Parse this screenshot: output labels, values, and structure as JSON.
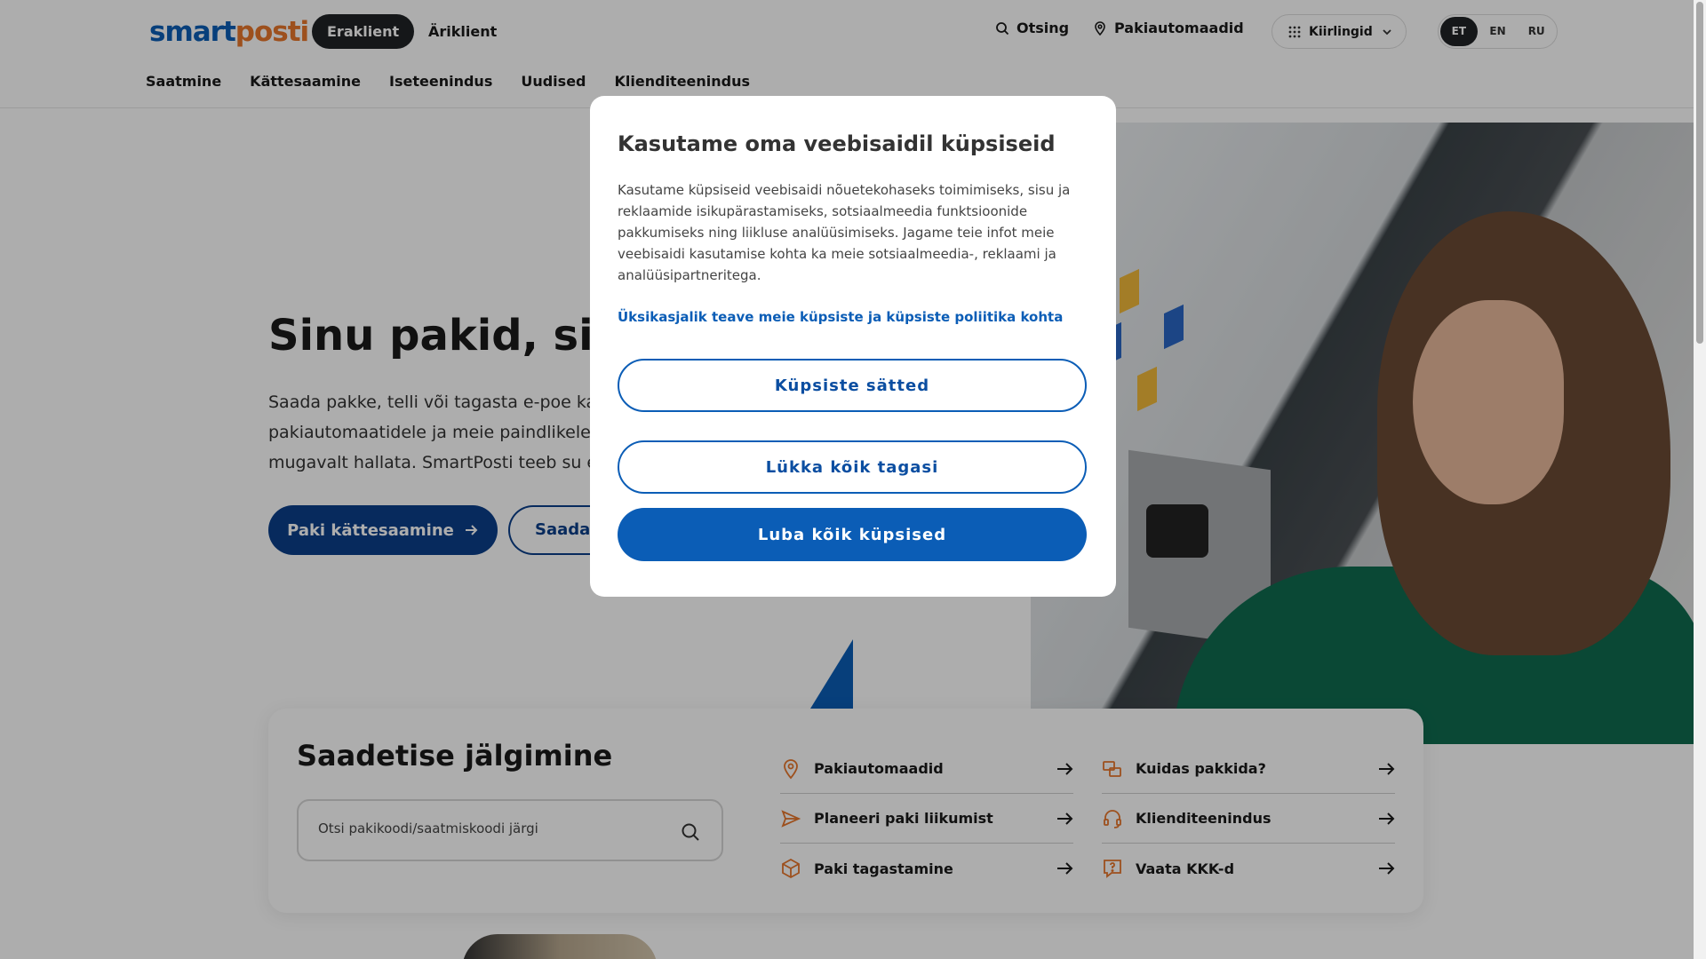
{
  "header": {
    "logo_part1": "smart",
    "logo_part2": "posti",
    "segment_active": "Eraklient",
    "segment_other": "Äriklient",
    "search_label": "Otsing",
    "lockers_label": "Pakiautomaadid",
    "quicklinks_label": "Kiirlingid",
    "languages": [
      "ET",
      "EN",
      "RU"
    ],
    "active_language": "ET"
  },
  "nav": [
    "Saatmine",
    "Kättesaamine",
    "Iseteenindus",
    "Uudised",
    "Klienditeenindus"
  ],
  "hero": {
    "title": "Sinu pakid, sinu",
    "text_line1": "Saada pakke, telli või tagasta e-poe kaup",
    "text_line2": "pakiautomaatidele ja meie paindlikele ta",
    "text_line3": "mugavalt hallata. SmartPosti teeb su elu",
    "primary_button": "Paki kättesaamine",
    "secondary_button": "Saada"
  },
  "tracking": {
    "title": "Saadetise jälgimine",
    "placeholder": "Otsi pakikoodi/saatmiskoodi järgi",
    "links": [
      {
        "label": "Pakiautomaadid",
        "icon": "location-pin-icon"
      },
      {
        "label": "Kuidas pakkida?",
        "icon": "packages-icon"
      },
      {
        "label": "Planeeri paki liikumist",
        "icon": "send-icon"
      },
      {
        "label": "Klienditeenindus",
        "icon": "headset-icon"
      },
      {
        "label": "Paki tagastamine",
        "icon": "box-return-icon"
      },
      {
        "label": "Vaata KKK-d",
        "icon": "faq-icon"
      }
    ]
  },
  "cookie_modal": {
    "title": "Kasutame oma veebisaidil küpsiseid",
    "body": "Kasutame küpsiseid veebisaidi nõuetekohaseks toimimiseks, sisu ja reklaamide isikupärastamiseks, sotsiaalmeedia funktsioonide pakkumiseks ning liikluse analüüsimiseks. Jagame teie infot meie veebisaidi kasutamise kohta ka meie sotsiaalmeedia-, reklaami ja analüüsipartneritega.",
    "policy_link": "Üksikasjalik teave meie küpsiste ja küpsiste poliitika kohta",
    "settings_button": "Küpsiste sätted",
    "reject_button": "Lükka kõik tagasi",
    "accept_button": "Luba kõik küpsised"
  },
  "colors": {
    "brand_blue": "#0b5db6",
    "brand_orange": "#e8762c",
    "dark": "#1f2326"
  }
}
